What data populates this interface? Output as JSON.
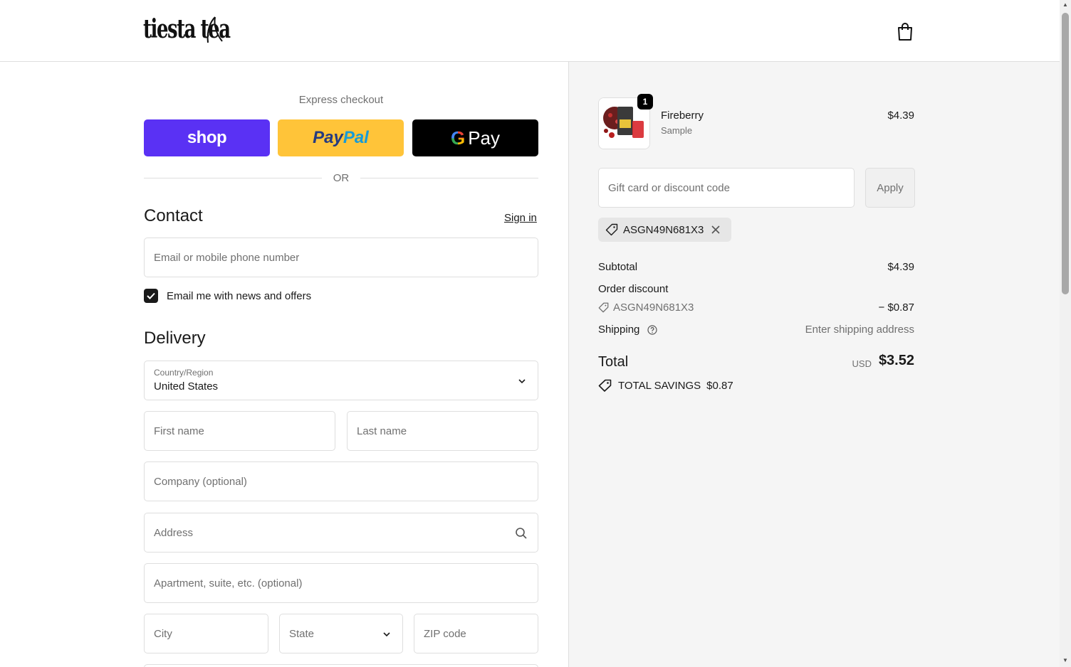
{
  "header": {
    "logo_text": "tiesta tea",
    "cart_icon": "shopping-bag-icon"
  },
  "express": {
    "title": "Express checkout",
    "shop_label": "shop",
    "paypal_label_1": "Pay",
    "paypal_label_2": "Pal",
    "gpay_g": "G",
    "gpay_label": "Pay",
    "or_label": "OR"
  },
  "contact": {
    "title": "Contact",
    "signin_label": "Sign in",
    "email_placeholder": "Email or mobile phone number",
    "newsletter_label": "Email me with news and offers",
    "newsletter_checked": true
  },
  "delivery": {
    "title": "Delivery",
    "country_label": "Country/Region",
    "country_value": "United States",
    "first_name_placeholder": "First name",
    "last_name_placeholder": "Last name",
    "company_placeholder": "Company (optional)",
    "address_placeholder": "Address",
    "apartment_placeholder": "Apartment, suite, etc. (optional)",
    "city_placeholder": "City",
    "state_placeholder": "State",
    "zip_placeholder": "ZIP code"
  },
  "summary": {
    "item": {
      "quantity": "1",
      "name": "Fireberry",
      "variant": "Sample",
      "price": "$4.39"
    },
    "discount_placeholder": "Gift card or discount code",
    "apply_label": "Apply",
    "applied_code": "ASGN49N681X3",
    "subtotal_label": "Subtotal",
    "subtotal_value": "$4.39",
    "order_discount_label": "Order discount",
    "discount_code": "ASGN49N681X3",
    "discount_value": "− $0.87",
    "shipping_label": "Shipping",
    "shipping_value": "Enter shipping address",
    "total_label": "Total",
    "currency": "USD",
    "total_value": "$3.52",
    "savings_label": "TOTAL SAVINGS",
    "savings_value": "$0.87"
  },
  "colors": {
    "shop_purple": "#5a31f4",
    "paypal_yellow": "#ffc439",
    "gpay_black": "#000000"
  }
}
